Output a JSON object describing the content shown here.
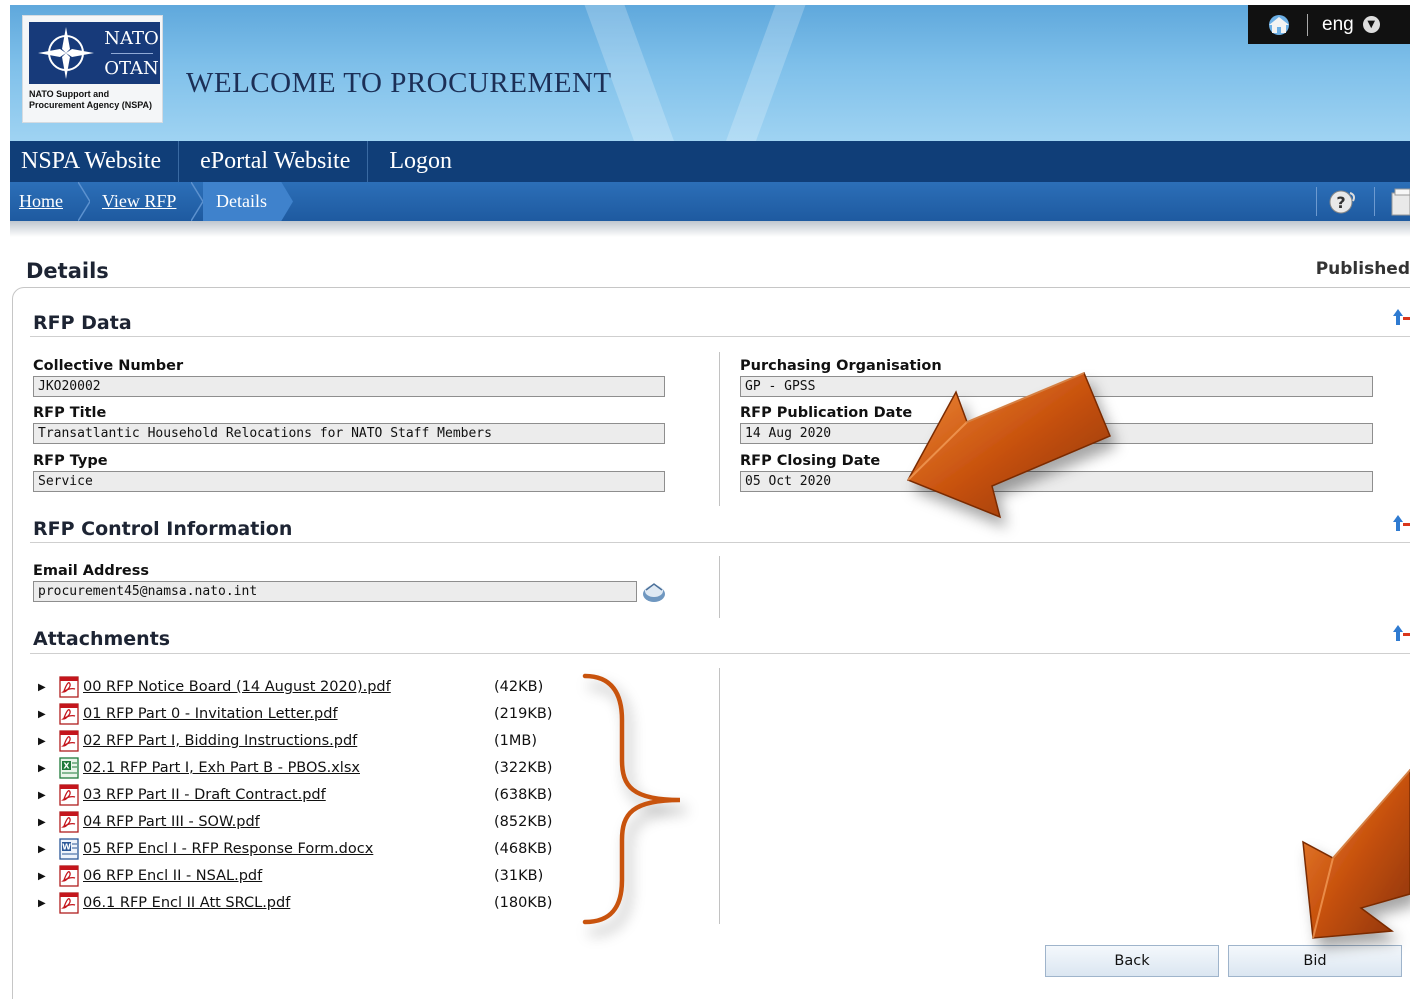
{
  "header": {
    "logo_top": "NATO",
    "logo_bottom": "OTAN",
    "logo_caption": "NATO Support and Procurement Agency (NSPA)",
    "title": "WELCOME TO PROCUREMENT",
    "language": "eng"
  },
  "nav": {
    "items": [
      "NSPA Website",
      "ePortal Website",
      "Logon"
    ]
  },
  "breadcrumb": {
    "items": [
      "Home",
      "View RFP",
      "Details"
    ]
  },
  "page": {
    "title": "Details",
    "status": "Published"
  },
  "rfp_data": {
    "heading": "RFP Data",
    "collective_number_label": "Collective Number",
    "collective_number": "JKO20002",
    "rfp_title_label": "RFP Title",
    "rfp_title": "Transatlantic Household Relocations for NATO Staff Members",
    "rfp_type_label": "RFP Type",
    "rfp_type": "Service",
    "purchasing_org_label": "Purchasing Organisation",
    "purchasing_org": "GP - GPSS",
    "publication_date_label": "RFP Publication Date",
    "publication_date": "14 Aug 2020",
    "closing_date_label": "RFP Closing Date",
    "closing_date": "05 Oct 2020"
  },
  "control_info": {
    "heading": "RFP Control Information",
    "email_label": "Email Address",
    "email": "procurement45@namsa.nato.int"
  },
  "attachments": {
    "heading": "Attachments",
    "items": [
      {
        "name": "00 RFP Notice Board (14 August 2020).pdf",
        "size": "(42KB)",
        "icon": "pdf-icon"
      },
      {
        "name": "01 RFP Part 0 - Invitation Letter.pdf",
        "size": "(219KB)",
        "icon": "pdf-icon"
      },
      {
        "name": "02 RFP Part I, Bidding Instructions.pdf",
        "size": "(1MB)",
        "icon": "pdf-icon"
      },
      {
        "name": "02.1 RFP Part I, Exh Part B - PBOS.xlsx",
        "size": "(322KB)",
        "icon": "excel-icon"
      },
      {
        "name": "03 RFP Part II - Draft Contract.pdf",
        "size": "(638KB)",
        "icon": "pdf-icon"
      },
      {
        "name": "04 RFP Part III - SOW.pdf",
        "size": "(852KB)",
        "icon": "pdf-icon"
      },
      {
        "name": "05 RFP Encl I - RFP Response Form.docx",
        "size": "(468KB)",
        "icon": "word-icon"
      },
      {
        "name": "06 RFP Encl II - NSAL.pdf",
        "size": "(31KB)",
        "icon": "pdf-icon"
      },
      {
        "name": "06.1 RFP Encl II Att SRCL.pdf",
        "size": "(180KB)",
        "icon": "pdf-icon"
      }
    ]
  },
  "actions": {
    "back": "Back",
    "bid": "Bid"
  },
  "colors": {
    "nav_bg": "#103e78",
    "breadcrumb_bg": "#1e5aa0",
    "annotation_orange": "#c8520e"
  }
}
